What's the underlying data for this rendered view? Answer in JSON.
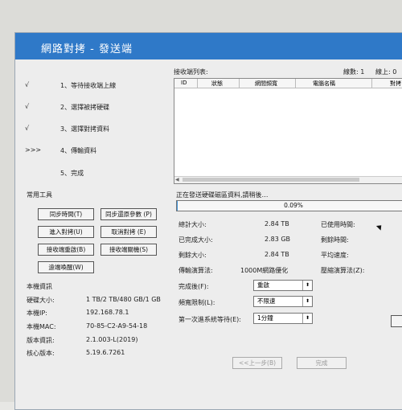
{
  "window": {
    "title": "網路對拷 - 發送端"
  },
  "steps": [
    {
      "mark": "√",
      "label": "1、等待接收端上線"
    },
    {
      "mark": "√",
      "label": "2、選擇被拷硬碟"
    },
    {
      "mark": "√",
      "label": "3、選擇對拷資料"
    },
    {
      "mark": ">>>",
      "label": "4、傳輸資料"
    },
    {
      "mark": "",
      "label": "5、完成"
    }
  ],
  "tools": {
    "heading": "常用工具",
    "sync_time": "同步時間(T)",
    "sync_restore_params": "同步還原參數 (P)",
    "enter_copy": "進入對拷(U)",
    "cancel_copy": "取消對拷 (E)",
    "receiver_restart": "接收端重啟(B)",
    "receiver_shutdown": "接收端關機(S)",
    "remote_wake": "遠端喚醒(W)"
  },
  "machine_info": {
    "heading": "本機資訊",
    "rows": [
      {
        "label": "硬碟大小:",
        "value": "1 TB/2 TB/480 GB/1 GB"
      },
      {
        "label": "本機IP:",
        "value": "192.168.78.1"
      },
      {
        "label": "本機MAC:",
        "value": "70-85-C2-A9-54-18"
      },
      {
        "label": "版本資訊:",
        "value": "2.1.003-L(2019)"
      },
      {
        "label": "核心版本:",
        "value": "5.19.6.7261"
      }
    ]
  },
  "receivers": {
    "label": "接收端列表:",
    "count_label": "線數: 1",
    "online_label": "線上: 0",
    "columns": [
      "ID",
      "狀態",
      "網間頻寬",
      "電腦名稱",
      "對拷"
    ]
  },
  "progress": {
    "status_text": "正在發送硬碟磁區資料,請稍後…",
    "percent_text": "0.09%",
    "fraction": 0.0009
  },
  "stats": {
    "total_label": "總計大小:",
    "total_value": "2.84 TB",
    "done_label": "已完成大小:",
    "done_value": "2.83 GB",
    "remain_label": "剩餘大小:",
    "remain_value": "2.84 TB",
    "algo_label": "傳輸演算法:",
    "algo_value": "1000M網路優化",
    "elapsed_label": "已使用時間:",
    "remain_time_label": "剩餘時間:",
    "avg_speed_label": "平均速度:",
    "compress_label": "壓縮演算法(Z):"
  },
  "options": {
    "after_label": "完成後(F):",
    "after_value": "重啟",
    "bandwidth_label": "頻寬限制(L):",
    "bandwidth_value": "不限速",
    "wait_label": "第一次進系統等待(E):",
    "wait_value": "1分鐘"
  },
  "nav": {
    "prev": "<<上一步(B)",
    "finish": "完成"
  },
  "colors": {
    "titlebar": "#2f79c8",
    "progress_fill": "#3a8fd6"
  }
}
